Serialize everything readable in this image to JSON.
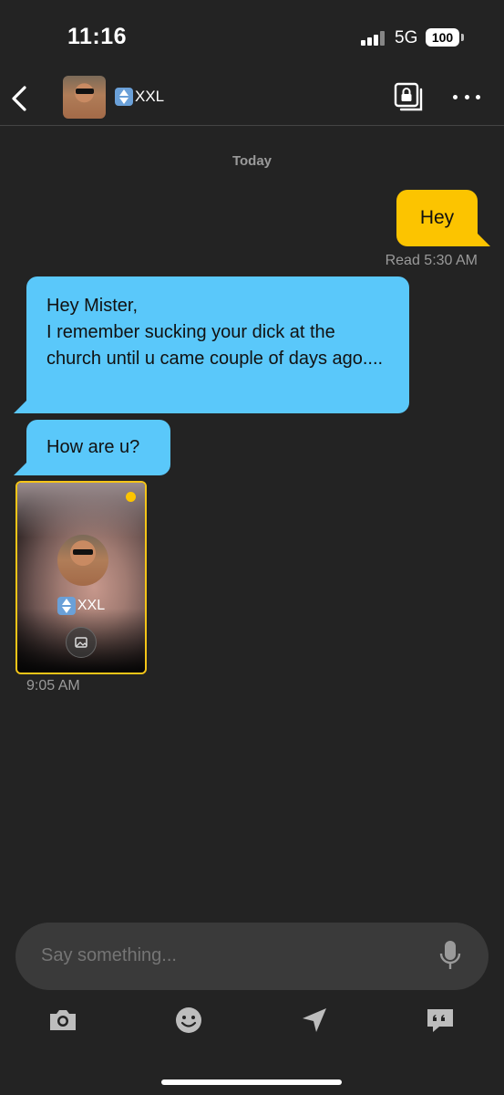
{
  "status": {
    "time": "11:16",
    "network": "5G",
    "battery": "100"
  },
  "header": {
    "name": "XXL",
    "avatar_icon": "profile-photo",
    "back_icon": "chevron-left-icon",
    "album_icon": "locked-album-icon",
    "more_icon": "more-icon"
  },
  "chat": {
    "day_label": "Today",
    "messages": [
      {
        "direction": "out",
        "text": "Hey",
        "receipt": "Read",
        "time": "5:30 AM"
      },
      {
        "direction": "in",
        "text": "Hey Mister,\nI remember sucking your dick at the church until u came couple of days ago...."
      },
      {
        "direction": "in",
        "text": "How are u?"
      }
    ],
    "photo_card": {
      "name": "XXL",
      "time": "9:05 AM",
      "unread_dot_color": "#fcc400"
    }
  },
  "composer": {
    "placeholder": "Say something..."
  },
  "toolbar": {
    "items": [
      "camera-icon",
      "emoji-icon",
      "location-icon",
      "saved-phrases-icon"
    ]
  },
  "colors": {
    "outgoing": "#fcc400",
    "incoming": "#5ac8fa",
    "background": "#232323"
  }
}
